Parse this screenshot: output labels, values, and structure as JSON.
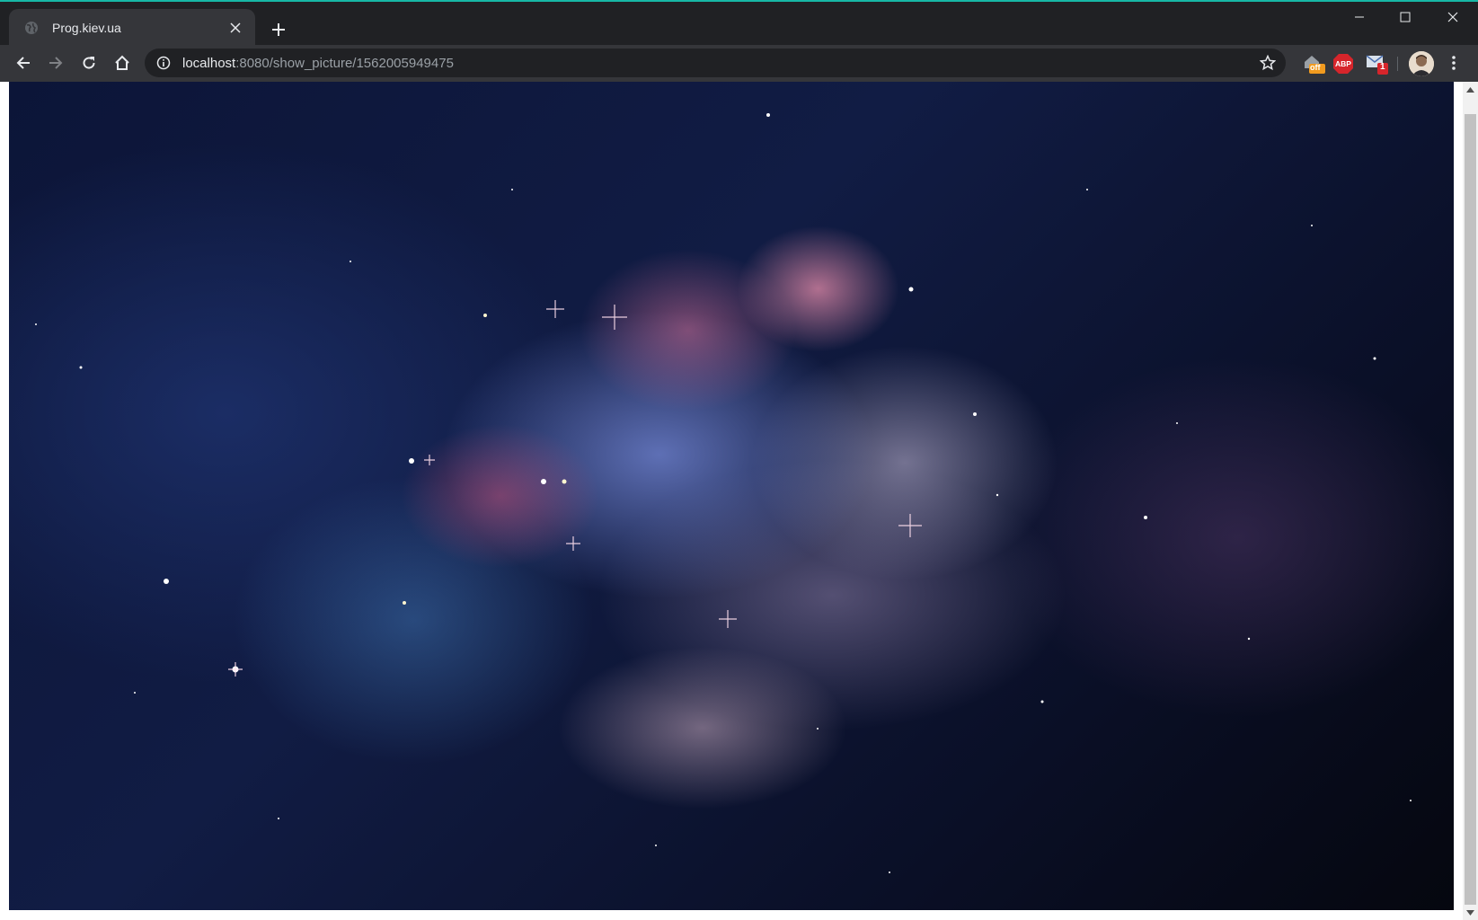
{
  "browser": {
    "tab": {
      "title": "Prog.kiev.ua"
    },
    "address_bar": {
      "host": "localhost",
      "path": ":8080/show_picture/1562005949475"
    },
    "extensions": {
      "home_off_badge": "off",
      "adblock_label": "ABP",
      "mail_badge": "1"
    },
    "accent_color": "#17b8a6"
  },
  "content": {
    "image": "nebula space picture"
  }
}
